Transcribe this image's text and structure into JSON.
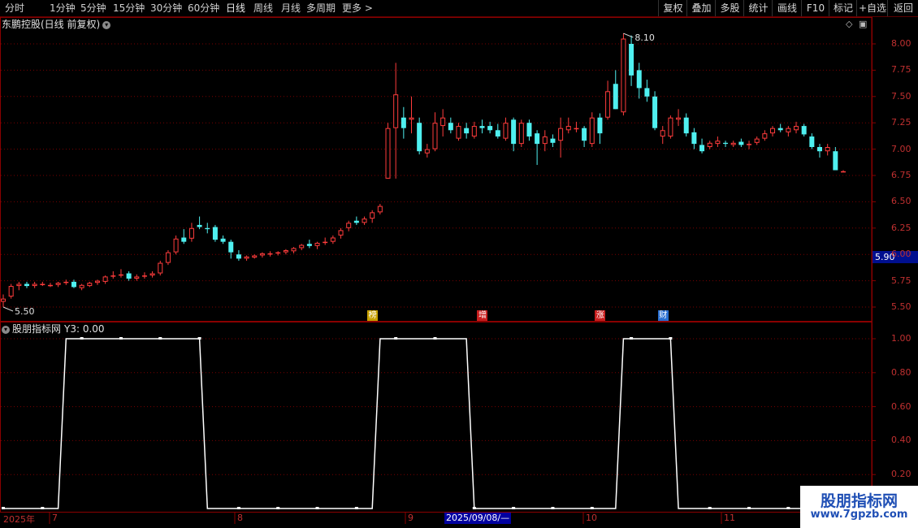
{
  "toolbar": {
    "periods": [
      "分时",
      "1分钟",
      "5分钟",
      "15分钟",
      "30分钟",
      "60分钟",
      "日线",
      "周线",
      "月线",
      "多周期",
      "更多 >"
    ],
    "active_period": "日线",
    "right_buttons": [
      "复权",
      "叠加",
      "多股",
      "统计",
      "画线",
      "F10",
      "标记",
      "+自选",
      "返回"
    ]
  },
  "main_panel": {
    "title": "东鹏控股(日线 前复权)",
    "expand_icon": "chevron-down-icon",
    "high_label": "8.10",
    "low_label": "5.50",
    "current_price": "5.90",
    "y_axis_labels": [
      "8.00",
      "7.75",
      "7.50",
      "7.25",
      "7.00",
      "6.75",
      "6.50",
      "6.25",
      "6.00",
      "5.75",
      "5.50"
    ],
    "event_markers": [
      {
        "label": "榜",
        "color": "#c7a000"
      },
      {
        "label": "增",
        "color": "#c81e1e"
      },
      {
        "label": "涨",
        "color": "#c81e1e"
      },
      {
        "label": "财",
        "color": "#2a6fd0"
      }
    ]
  },
  "sub_panel": {
    "title": "股朋指标网",
    "value_label": "Y3: 0.00",
    "y_axis_labels": [
      "1.00",
      "0.80",
      "0.60",
      "0.40",
      "0.20"
    ]
  },
  "x_axis": {
    "labels": [
      "2025年",
      "7",
      "8",
      "9",
      "10",
      "11"
    ],
    "cursor_date": "2025/09/08/—"
  },
  "watermark": {
    "line1": "股朋指标网",
    "line2": "www.7gpzb.com"
  },
  "colors": {
    "up": "#ff3c3c",
    "down": "#4ff0f0",
    "grid": "#7a0000",
    "axis_text": "#c03030",
    "indicator_line": "#ffffff"
  },
  "chart_data": [
    {
      "type": "candlestick",
      "title": "东鹏控股(日线 前复权)",
      "ylim": [
        5.45,
        8.15
      ],
      "candles": [
        [
          5.55,
          5.62,
          5.5,
          5.58
        ],
        [
          5.6,
          5.72,
          5.58,
          5.7
        ],
        [
          5.7,
          5.74,
          5.66,
          5.72
        ],
        [
          5.72,
          5.74,
          5.68,
          5.7
        ],
        [
          5.7,
          5.74,
          5.68,
          5.72
        ],
        [
          5.72,
          5.74,
          5.7,
          5.72
        ],
        [
          5.71,
          5.73,
          5.69,
          5.71
        ],
        [
          5.71,
          5.74,
          5.69,
          5.73
        ],
        [
          5.73,
          5.76,
          5.71,
          5.74
        ],
        [
          5.74,
          5.76,
          5.68,
          5.69
        ],
        [
          5.68,
          5.72,
          5.66,
          5.71
        ],
        [
          5.7,
          5.74,
          5.69,
          5.73
        ],
        [
          5.73,
          5.76,
          5.71,
          5.75
        ],
        [
          5.74,
          5.8,
          5.72,
          5.79
        ],
        [
          5.79,
          5.84,
          5.77,
          5.8
        ],
        [
          5.8,
          5.86,
          5.78,
          5.81
        ],
        [
          5.82,
          5.84,
          5.75,
          5.77
        ],
        [
          5.77,
          5.81,
          5.75,
          5.79
        ],
        [
          5.79,
          5.83,
          5.77,
          5.8
        ],
        [
          5.8,
          5.84,
          5.78,
          5.82
        ],
        [
          5.82,
          5.94,
          5.8,
          5.92
        ],
        [
          5.92,
          6.04,
          5.9,
          6.02
        ],
        [
          6.02,
          6.18,
          6.0,
          6.15
        ],
        [
          6.16,
          6.24,
          6.1,
          6.12
        ],
        [
          6.15,
          6.3,
          6.12,
          6.25
        ],
        [
          6.28,
          6.36,
          6.24,
          6.26
        ],
        [
          6.25,
          6.3,
          6.2,
          6.24
        ],
        [
          6.26,
          6.28,
          6.12,
          6.14
        ],
        [
          6.15,
          6.18,
          6.1,
          6.12
        ],
        [
          6.12,
          6.14,
          5.96,
          6.02
        ],
        [
          6.0,
          6.04,
          5.94,
          5.96
        ],
        [
          5.96,
          5.99,
          5.94,
          5.98
        ],
        [
          5.97,
          6.0,
          5.96,
          5.99
        ],
        [
          5.99,
          6.02,
          5.97,
          6.01
        ],
        [
          6.01,
          6.03,
          5.98,
          6.01
        ],
        [
          6.01,
          6.03,
          5.99,
          6.02
        ],
        [
          6.02,
          6.05,
          6.0,
          6.04
        ],
        [
          6.03,
          6.07,
          6.01,
          6.06
        ],
        [
          6.06,
          6.1,
          6.04,
          6.09
        ],
        [
          6.1,
          6.14,
          6.06,
          6.08
        ],
        [
          6.08,
          6.12,
          6.05,
          6.11
        ],
        [
          6.11,
          6.16,
          6.09,
          6.12
        ],
        [
          6.12,
          6.18,
          6.1,
          6.16
        ],
        [
          6.18,
          6.25,
          6.15,
          6.23
        ],
        [
          6.25,
          6.32,
          6.22,
          6.3
        ],
        [
          6.32,
          6.36,
          6.28,
          6.3
        ],
        [
          6.3,
          6.36,
          6.28,
          6.34
        ],
        [
          6.34,
          6.42,
          6.3,
          6.4
        ],
        [
          6.4,
          6.48,
          6.38,
          6.46
        ],
        [
          6.72,
          7.25,
          6.72,
          7.2
        ],
        [
          7.2,
          7.82,
          6.72,
          7.52
        ],
        [
          7.3,
          7.4,
          7.1,
          7.2
        ],
        [
          7.28,
          7.5,
          7.15,
          7.3
        ],
        [
          7.25,
          7.3,
          6.95,
          6.98
        ],
        [
          6.96,
          7.05,
          6.92,
          7.0
        ],
        [
          7.0,
          7.35,
          6.98,
          7.25
        ],
        [
          7.22,
          7.38,
          7.12,
          7.3
        ],
        [
          7.25,
          7.3,
          7.15,
          7.18
        ],
        [
          7.1,
          7.25,
          7.08,
          7.22
        ],
        [
          7.2,
          7.25,
          7.1,
          7.15
        ],
        [
          7.12,
          7.26,
          7.1,
          7.22
        ],
        [
          7.22,
          7.28,
          7.15,
          7.2
        ],
        [
          7.22,
          7.26,
          7.15,
          7.18
        ],
        [
          7.18,
          7.24,
          7.1,
          7.12
        ],
        [
          7.1,
          7.3,
          7.08,
          7.25
        ],
        [
          7.28,
          7.3,
          6.98,
          7.05
        ],
        [
          7.05,
          7.28,
          7.02,
          7.25
        ],
        [
          7.25,
          7.28,
          7.08,
          7.12
        ],
        [
          7.15,
          7.18,
          6.85,
          7.05
        ],
        [
          7.05,
          7.18,
          6.98,
          7.12
        ],
        [
          7.1,
          7.14,
          7.02,
          7.06
        ],
        [
          7.08,
          7.3,
          6.92,
          7.2
        ],
        [
          7.18,
          7.3,
          7.15,
          7.22
        ],
        [
          7.2,
          7.26,
          7.16,
          7.2
        ],
        [
          7.2,
          7.22,
          7.02,
          7.08
        ],
        [
          7.05,
          7.35,
          7.02,
          7.3
        ],
        [
          7.3,
          7.34,
          7.05,
          7.15
        ],
        [
          7.3,
          7.65,
          7.28,
          7.55
        ],
        [
          7.62,
          7.75,
          7.38,
          7.38
        ],
        [
          7.35,
          8.1,
          7.32,
          8.05
        ],
        [
          8.0,
          8.08,
          7.6,
          7.7
        ],
        [
          7.75,
          7.82,
          7.48,
          7.58
        ],
        [
          7.58,
          7.66,
          7.45,
          7.5
        ],
        [
          7.5,
          7.55,
          7.18,
          7.2
        ],
        [
          7.12,
          7.22,
          7.05,
          7.18
        ],
        [
          7.12,
          7.32,
          7.1,
          7.3
        ],
        [
          7.28,
          7.38,
          7.22,
          7.3
        ],
        [
          7.3,
          7.34,
          7.12,
          7.15
        ],
        [
          7.16,
          7.2,
          7.0,
          7.05
        ],
        [
          7.04,
          7.1,
          6.96,
          6.98
        ],
        [
          7.02,
          7.08,
          7.0,
          7.06
        ],
        [
          7.05,
          7.12,
          7.02,
          7.08
        ],
        [
          7.06,
          7.08,
          7.02,
          7.05
        ],
        [
          7.04,
          7.08,
          7.02,
          7.06
        ],
        [
          7.07,
          7.1,
          7.02,
          7.04
        ],
        [
          7.04,
          7.08,
          7.0,
          7.05
        ],
        [
          7.06,
          7.12,
          7.04,
          7.1
        ],
        [
          7.1,
          7.18,
          7.08,
          7.15
        ],
        [
          7.15,
          7.22,
          7.12,
          7.2
        ],
        [
          7.2,
          7.24,
          7.16,
          7.18
        ],
        [
          7.16,
          7.22,
          7.12,
          7.2
        ],
        [
          7.18,
          7.26,
          7.15,
          7.22
        ],
        [
          7.22,
          7.24,
          7.12,
          7.14
        ],
        [
          7.12,
          7.15,
          7.0,
          7.02
        ],
        [
          7.02,
          7.05,
          6.92,
          6.98
        ],
        [
          6.98,
          7.05,
          6.94,
          7.02
        ],
        [
          6.98,
          7.02,
          6.8,
          6.8
        ],
        [
          6.79,
          6.8,
          6.78,
          6.79
        ]
      ]
    },
    {
      "type": "line",
      "title": "股朋指标网",
      "name": "Y3",
      "ylim": [
        0,
        1
      ],
      "values": [
        0,
        0,
        0,
        0,
        0,
        0,
        0,
        0,
        1,
        1,
        1,
        1,
        1,
        1,
        1,
        1,
        1,
        1,
        1,
        1,
        1,
        1,
        1,
        1,
        1,
        1,
        0,
        0,
        0,
        0,
        0,
        0,
        0,
        0,
        0,
        0,
        0,
        0,
        0,
        0,
        0,
        0,
        0,
        0,
        0,
        0,
        0,
        0,
        1,
        1,
        1,
        1,
        1,
        1,
        1,
        1,
        1,
        1,
        1,
        1,
        0,
        0,
        0,
        0,
        0,
        0,
        0,
        0,
        0,
        0,
        0,
        0,
        0,
        0,
        0,
        0,
        0,
        0,
        0,
        1,
        1,
        1,
        1,
        1,
        1,
        1,
        0,
        0,
        0,
        0,
        0,
        0,
        0,
        0,
        0,
        0,
        0,
        0,
        0,
        0,
        0,
        0,
        0,
        0,
        0,
        0,
        0,
        0,
        0,
        0,
        0,
        0,
        0
      ]
    }
  ]
}
